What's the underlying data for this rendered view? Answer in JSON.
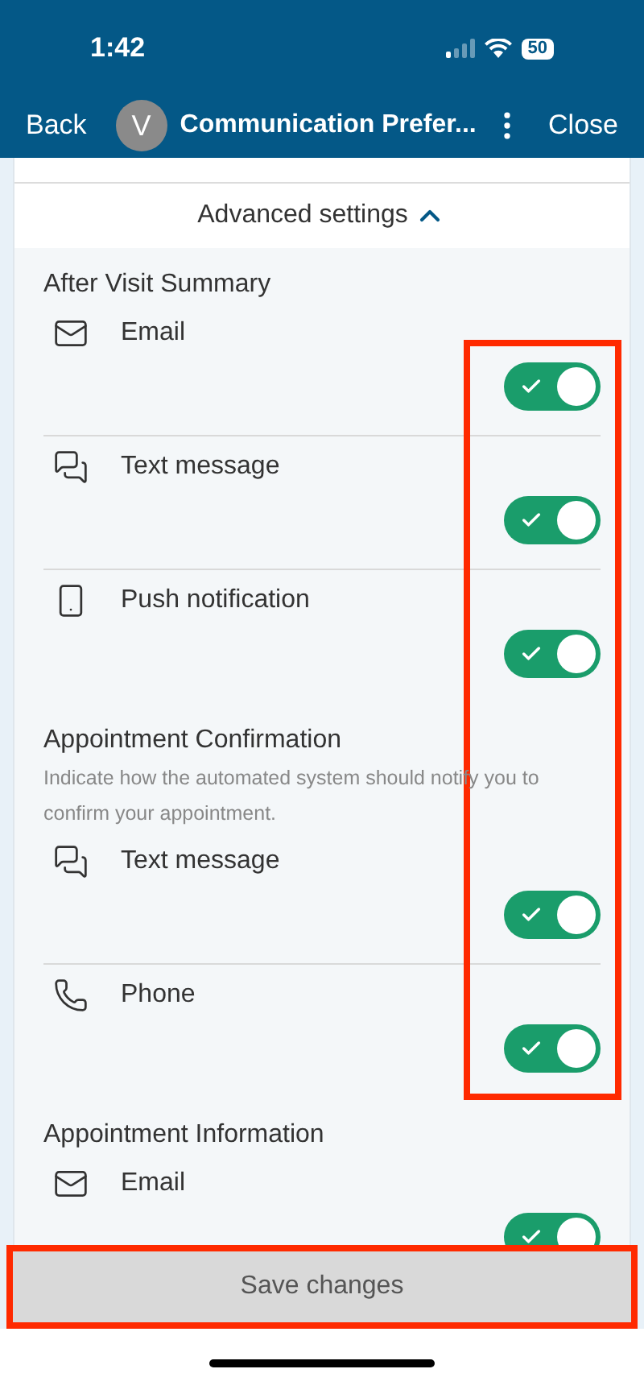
{
  "status_bar": {
    "time": "1:42",
    "battery": "50"
  },
  "header": {
    "back": "Back",
    "avatar": "V",
    "title": "Communication Prefer...",
    "close": "Close"
  },
  "advanced_settings": {
    "label": "Advanced settings",
    "expanded": true
  },
  "toggles_highlighted": true,
  "sections": [
    {
      "title": "After Visit Summary",
      "items": [
        {
          "kind": "email",
          "label": "Email",
          "on": true
        },
        {
          "kind": "text",
          "label": "Text message",
          "on": true
        },
        {
          "kind": "push",
          "label": "Push notification",
          "on": true
        }
      ]
    },
    {
      "title": "Appointment Confirmation",
      "description": "Indicate how the automated system should notify you to confirm your appointment.",
      "items": [
        {
          "kind": "text",
          "label": "Text message",
          "on": true
        },
        {
          "kind": "phone",
          "label": "Phone",
          "on": true
        }
      ]
    },
    {
      "title": "Appointment Information",
      "items": [
        {
          "kind": "email",
          "label": "Email",
          "on": true
        }
      ]
    }
  ],
  "save_button": {
    "label": "Save changes",
    "highlighted": true
  }
}
